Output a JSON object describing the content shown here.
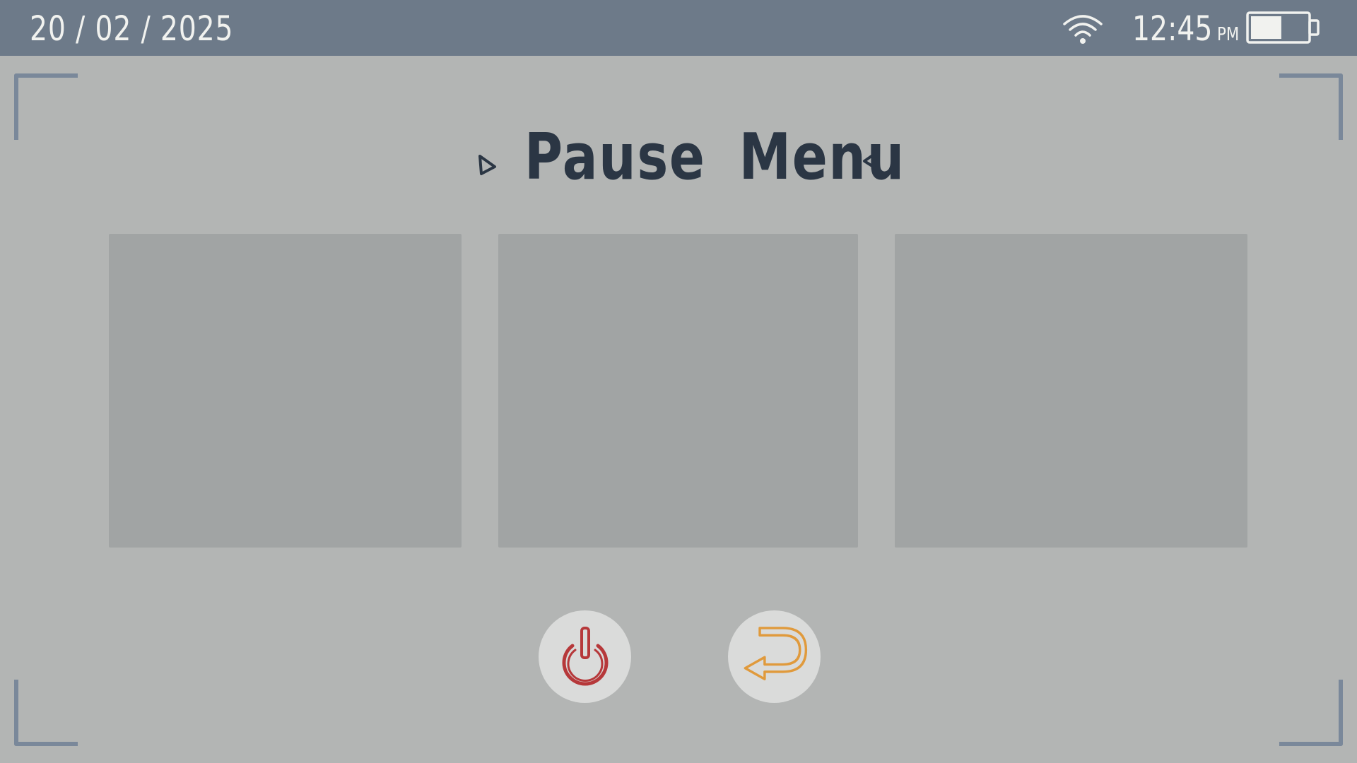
{
  "status_bar": {
    "date": "20 / 02 / 2025",
    "time": "12:45",
    "ampm": "PM",
    "wifi_icon": "wifi-icon",
    "battery_icon": "battery-icon",
    "battery_level": 0.55
  },
  "menu": {
    "title": "Pause Menu",
    "left_arrow_icon": "triangle-right-icon",
    "right_arrow_icon": "triangle-left-icon"
  },
  "panels": [
    {
      "label": ""
    },
    {
      "label": ""
    },
    {
      "label": ""
    }
  ],
  "buttons": {
    "power_icon": "power-icon",
    "back_icon": "back-arrow-icon"
  },
  "colors": {
    "background": "#b3b5b4",
    "status_bar": "#6d7a89",
    "panel": "#a1a4a4",
    "title": "#2b3644",
    "power": "#b6383a",
    "back": "#e09a3c",
    "corner": "#7a889a"
  }
}
